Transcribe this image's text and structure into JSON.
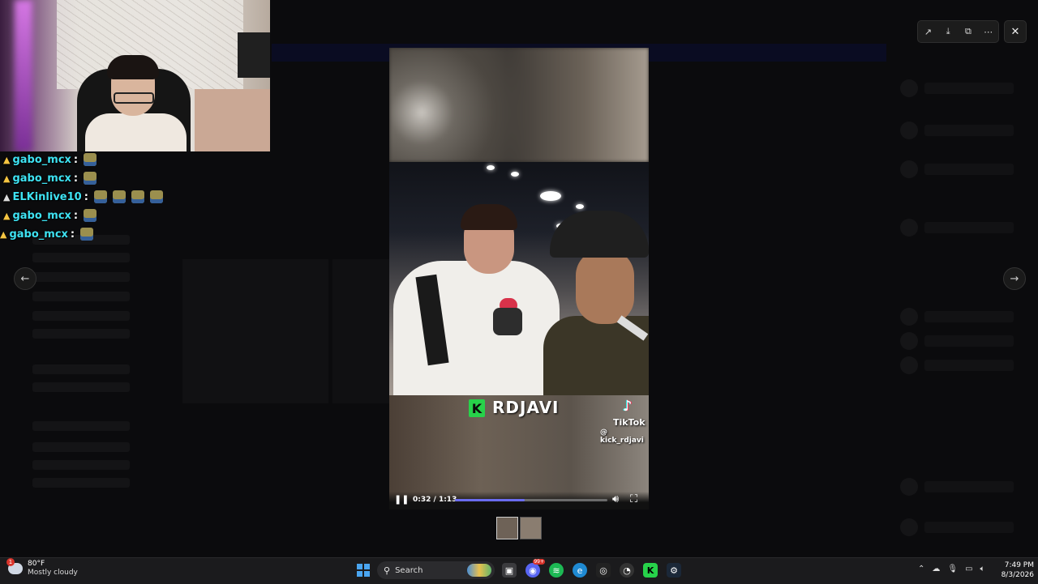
{
  "chat": [
    {
      "user": "gabo_mcx",
      "sep": ":",
      "emotes": 1
    },
    {
      "user": "gabo_mcx",
      "sep": ":",
      "emotes": 1
    },
    {
      "user": "ELKinlive10",
      "sep": ":",
      "emotes": 4
    },
    {
      "user": "gabo_mcx",
      "sep": ":",
      "emotes": 1
    },
    {
      "user": "gabo_mcx",
      "sep": ":",
      "emotes": 1
    }
  ],
  "viewer": {
    "share_icon": "share-icon",
    "download_icon": "download-icon",
    "open_icon": "open-external-icon",
    "more_icon": "more-icon",
    "close_icon": "close-icon",
    "prev_icon": "arrow-left-icon",
    "next_icon": "arrow-right-icon"
  },
  "video": {
    "channel": "RDJAVI",
    "channel_logo": "K",
    "platform": "TikTok",
    "handle": "@ kick_rdjavi",
    "time": "0:32 / 1:13",
    "progress": 0.46
  },
  "taskbar": {
    "weather_badge": "1",
    "temp": "80°F",
    "condition": "Mostly cloudy",
    "search": "Search",
    "discord_badge": "99+",
    "time": "7:49 PM",
    "date": "8/3/2026"
  },
  "colors": {
    "chat_name": "#3ee2f2",
    "accent": "#6a6cf0",
    "kick_green": "#27d24a"
  }
}
